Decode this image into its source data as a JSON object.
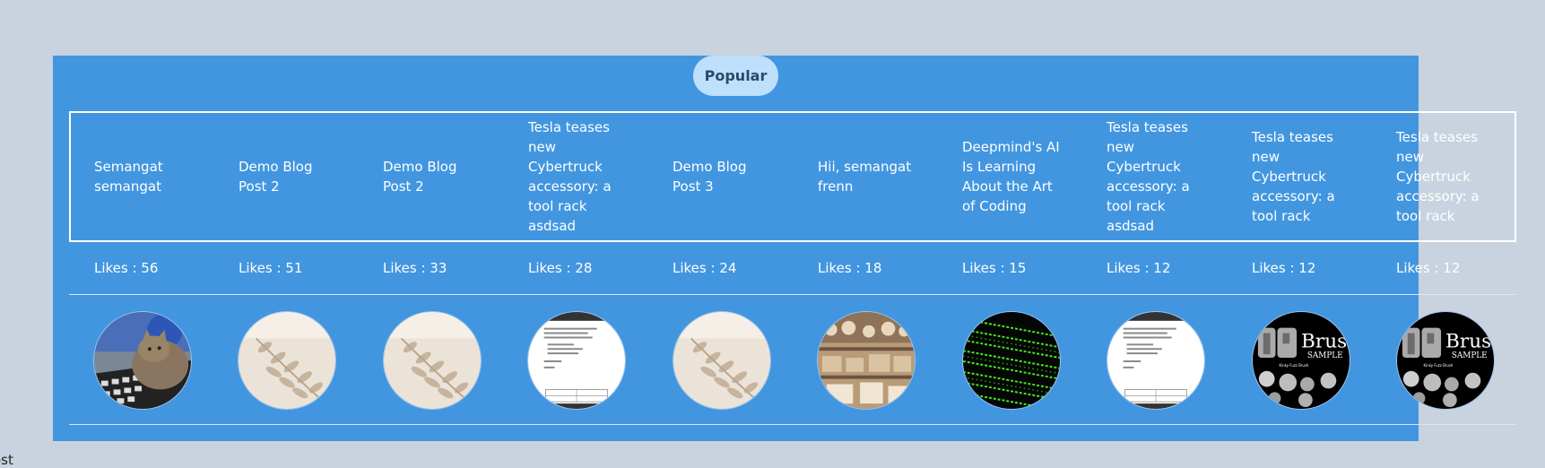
{
  "section": {
    "title": "Popular",
    "footer_fragment": "ost"
  },
  "colors": {
    "page_bg": "#c9d3df",
    "panel_bg": "#4296e0",
    "pill_bg": "#bfe0fb"
  },
  "posts": [
    {
      "title": "Semangat semangat",
      "likes": "Likes : 56",
      "image": "cat-laptop-image"
    },
    {
      "title": "Demo Blog Post 2",
      "likes": "Likes : 51",
      "image": "leaf-shadow-image"
    },
    {
      "title": "Demo Blog Post 2",
      "likes": "Likes : 33",
      "image": "leaf-shadow-image"
    },
    {
      "title": "Tesla teases new Cybertruck accessory: a tool rack asdsad",
      "likes": "Likes : 28",
      "image": "document-screenshot-image"
    },
    {
      "title": "Demo Blog Post 3",
      "likes": "Likes : 24",
      "image": "leaf-shadow-image"
    },
    {
      "title": "Hii, semangat frenn",
      "likes": "Likes : 18",
      "image": "food-shelf-image"
    },
    {
      "title": "Deepmind's AI Is Learning About the Art of Coding",
      "likes": "Likes : 15",
      "image": "green-code-image"
    },
    {
      "title": "Tesla teases new Cybertruck accessory: a tool rack asdsad",
      "likes": "Likes : 12",
      "image": "document-screenshot-image"
    },
    {
      "title": "Tesla teases new Cybertruck accessory: a tool rack",
      "likes": "Likes : 12",
      "image": "brush-sample-image"
    },
    {
      "title": "Tesla teases new Cybertruck accessory: a tool rack",
      "likes": "Likes : 12",
      "image": "brush-sample-image"
    }
  ]
}
